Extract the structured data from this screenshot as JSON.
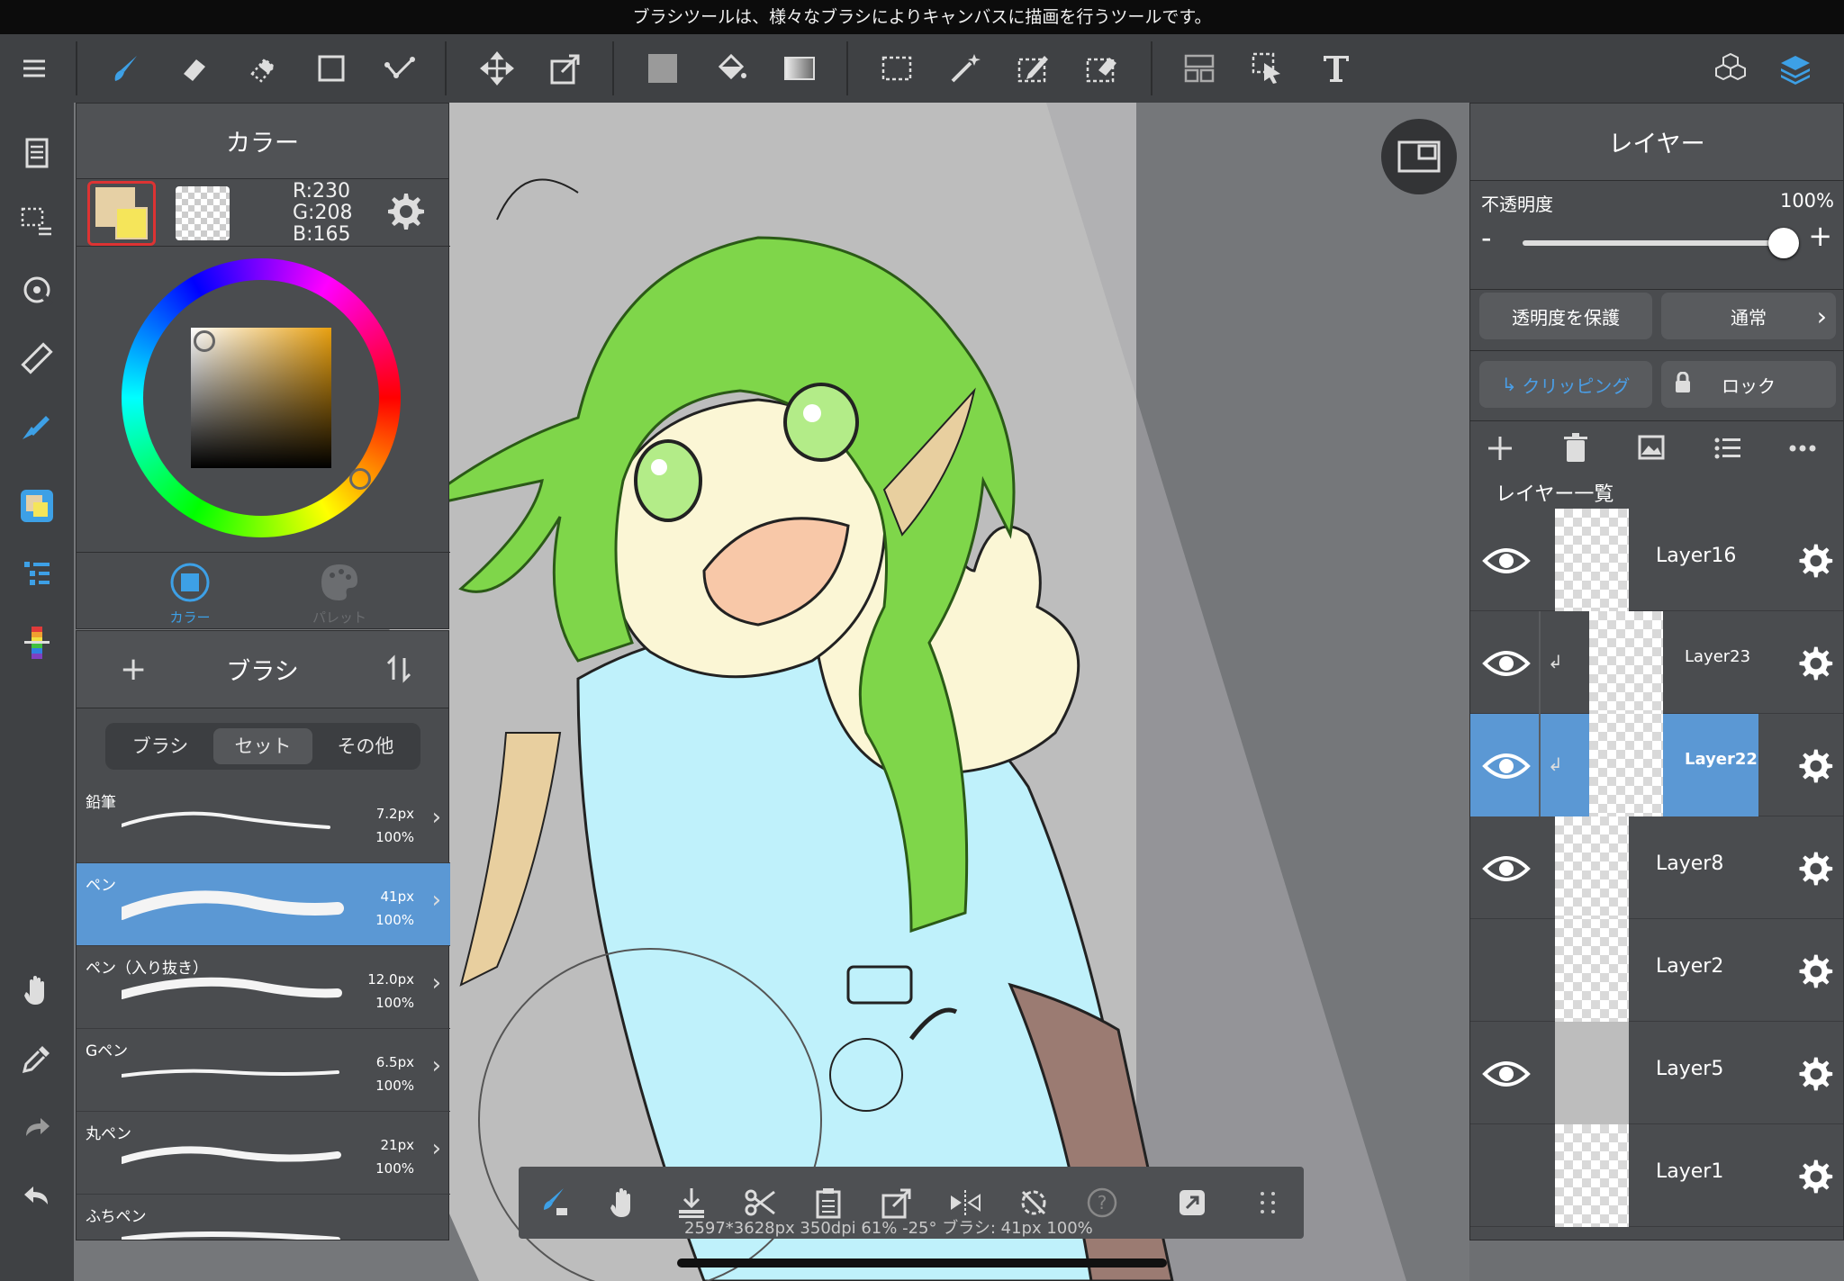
{
  "status_message": "ブラシツールは、様々なブラシによりキャンバスに描画を行うツールです。",
  "toolbar": {
    "tools": [
      "menu-icon",
      "brush-icon",
      "eraser-icon",
      "blur-eraser-icon",
      "square-icon",
      "move-points-icon",
      "move-icon",
      "transform-icon",
      "fill-color-icon",
      "bucket-icon",
      "gradient-icon",
      "select-rect-icon",
      "magic-wand-icon",
      "select-pen-icon",
      "select-eraser-icon",
      "filter-icon",
      "select-move-icon",
      "text-icon",
      "3d-icon",
      "layers-icon"
    ]
  },
  "color_panel": {
    "title": "カラー",
    "rgb": {
      "r": "R:230",
      "g": "G:208",
      "b": "B:165"
    },
    "foreground": "#e6d0a5",
    "tabs": [
      {
        "label": "カラー",
        "active": true
      },
      {
        "label": "パレット",
        "active": false
      }
    ]
  },
  "brush_panel": {
    "title": "ブラシ",
    "tabs": [
      "ブラシ",
      "セット",
      "その他"
    ],
    "active_tab": "セット",
    "brushes": [
      {
        "name": "鉛筆",
        "size": "7.2px",
        "opacity": "100%"
      },
      {
        "name": "ペン",
        "size": "41px",
        "opacity": "100%",
        "selected": true
      },
      {
        "name": "ペン（入り抜き）",
        "size": "12.0px",
        "opacity": "100%"
      },
      {
        "name": "Gペン",
        "size": "6.5px",
        "opacity": "100%"
      },
      {
        "name": "丸ペン",
        "size": "21px",
        "opacity": "100%"
      },
      {
        "name": "ふちペン",
        "size": "",
        "opacity": ""
      }
    ]
  },
  "layer_panel": {
    "title": "レイヤー",
    "opacity_label": "不透明度",
    "opacity_value": "100%",
    "opacity_level": 1.0,
    "protect_alpha": "透明度を保護",
    "blend_mode": "通常",
    "clipping": "クリッピング",
    "lock": "ロック",
    "list_title": "レイヤー一覧",
    "layers": [
      {
        "name": "Layer16",
        "visible": true,
        "clipped": false,
        "selected": false
      },
      {
        "name": "Layer23",
        "visible": true,
        "clipped": true,
        "selected": false
      },
      {
        "name": "Layer22",
        "visible": true,
        "clipped": true,
        "selected": true
      },
      {
        "name": "Layer8",
        "visible": true,
        "clipped": false,
        "selected": false
      },
      {
        "name": "Layer2",
        "visible": false,
        "clipped": false,
        "selected": false
      },
      {
        "name": "Layer5",
        "visible": true,
        "clipped": false,
        "selected": false
      },
      {
        "name": "Layer1",
        "visible": false,
        "clipped": false,
        "selected": false
      }
    ]
  },
  "canvas_info": "2597*3628px 350dpi 61% -25° ブラシ: 41px 100%",
  "colors": {
    "accent": "#4a90d9",
    "selected_row": "#5b98d4",
    "hair": "#7fd64a",
    "shirt": "#bff1fb",
    "skin": "#fbf6d5"
  }
}
